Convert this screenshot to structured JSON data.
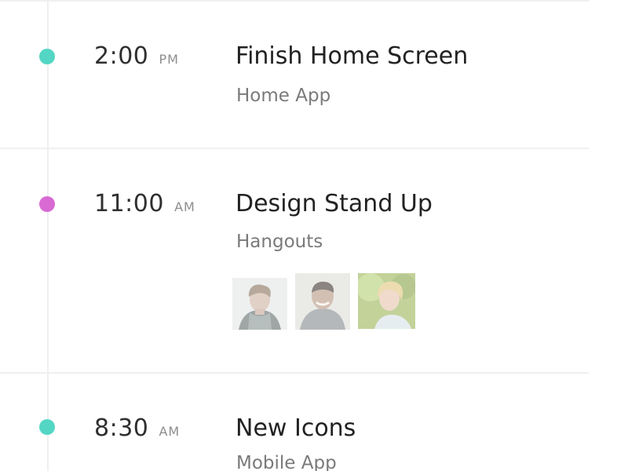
{
  "timeline": {
    "events": [
      {
        "time": "2:00",
        "period": "PM",
        "title": "Finish Home Screen",
        "subtitle": "Home App",
        "dot_color": "#54d6c4"
      },
      {
        "time": "11:00",
        "period": "AM",
        "title": "Design Stand Up",
        "subtitle": "Hangouts",
        "dot_color": "#d96ad4",
        "attendees": [
          {
            "icon": "male-avatar-photo-1"
          },
          {
            "icon": "male-avatar-photo-2"
          },
          {
            "icon": "female-avatar-photo-1"
          }
        ]
      },
      {
        "time": "8:30",
        "period": "AM",
        "title": "New Icons",
        "subtitle": "Mobile App",
        "dot_color": "#54d6c4"
      }
    ]
  }
}
